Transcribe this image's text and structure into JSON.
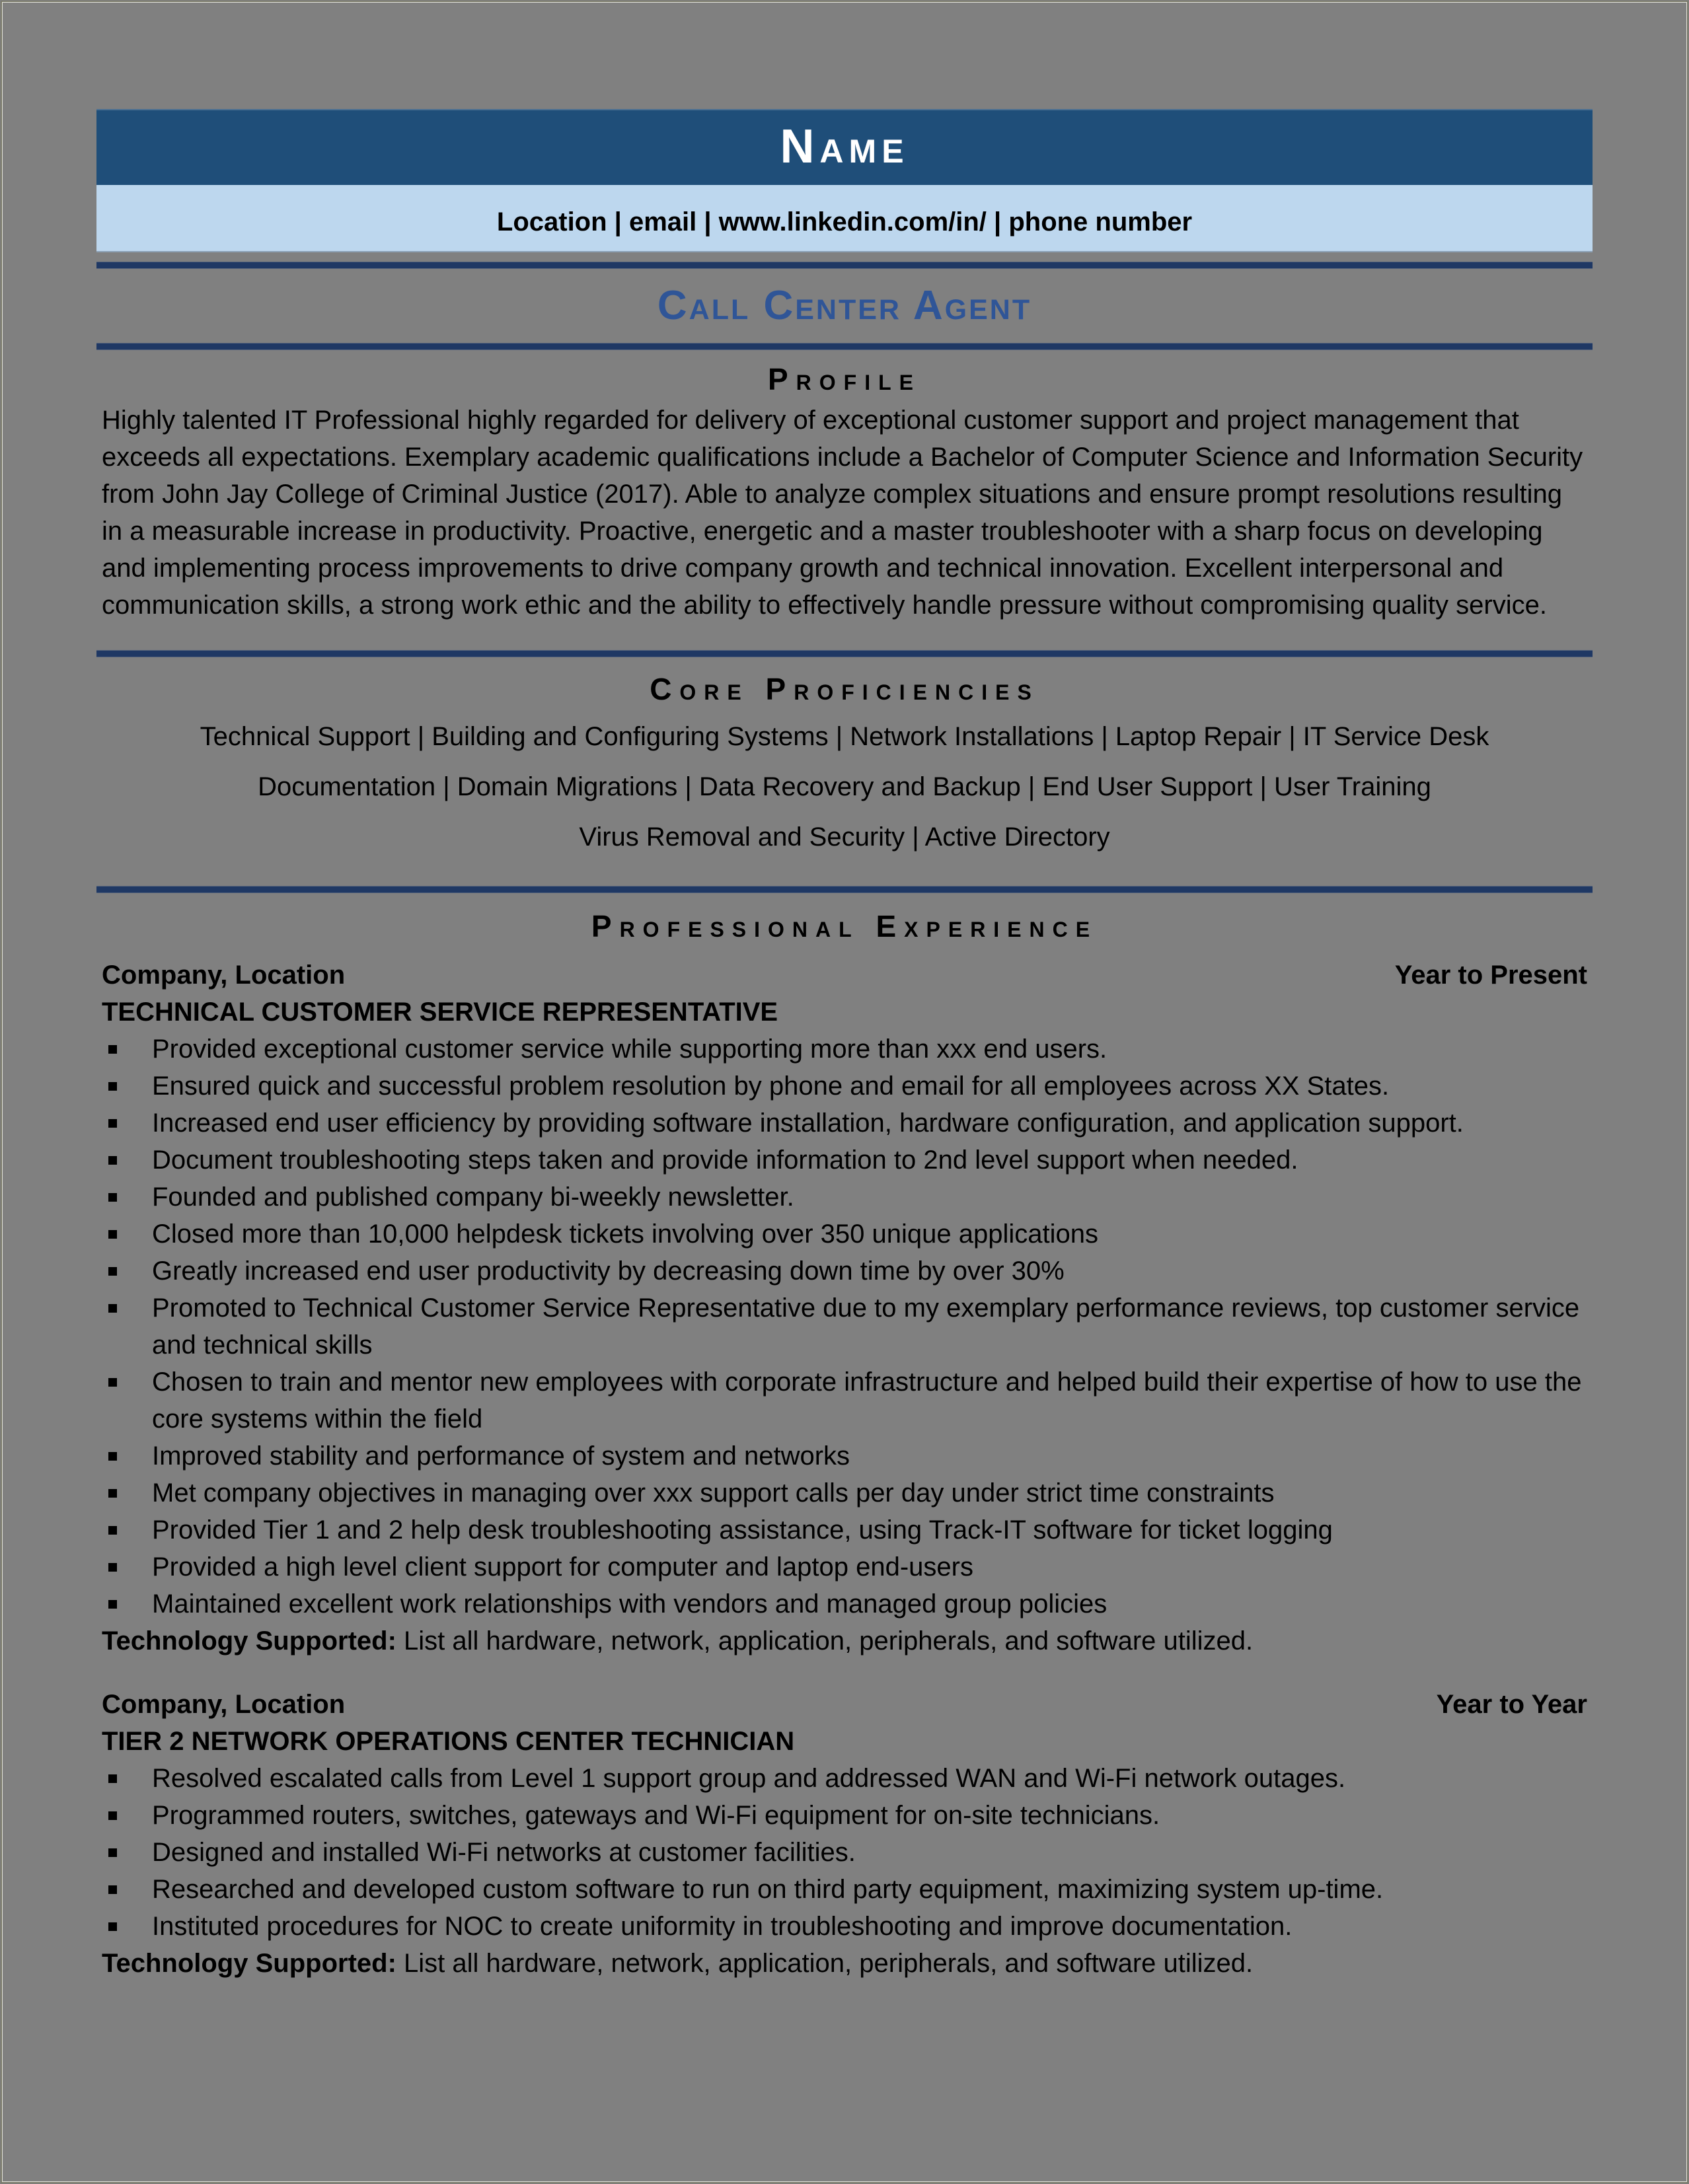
{
  "header": {
    "name": "Name",
    "contact": "Location | email | www.linkedin.com/in/ | phone number",
    "job_title": "Call Center Agent"
  },
  "colors": {
    "page_background": "#808080",
    "name_band": "#1f4e79",
    "contact_band": "#bdd7ee",
    "rule": "#1f3864",
    "job_title": "#2f5597"
  },
  "profile": {
    "heading": "Profile",
    "text": "Highly talented IT Professional highly regarded for delivery of exceptional customer support and project management that exceeds all expectations. Exemplary academic qualifications include a Bachelor of Computer Science and Information Security from John Jay College of Criminal Justice (2017). Able to analyze complex situations and ensure prompt resolutions resulting in a measurable increase in productivity. Proactive, energetic and a master troubleshooter with a sharp focus on developing and implementing process improvements to drive company growth and technical innovation. Excellent interpersonal and communication skills, a strong work ethic and the ability to effectively handle pressure without compromising quality service."
  },
  "core_proficiencies": {
    "heading": "Core Proficiencies",
    "lines": [
      "Technical Support | Building and Configuring Systems | Network Installations | Laptop Repair | IT Service Desk",
      "Documentation | Domain Migrations | Data Recovery and Backup | End User Support | User Training",
      "Virus Removal and Security | Active Directory"
    ]
  },
  "experience": {
    "heading": "Professional Experience",
    "jobs": [
      {
        "company": "Company, Location",
        "dates": "Year to Present",
        "role": "TECHNICAL CUSTOMER SERVICE REPRESENTATIVE",
        "bullets": [
          "Provided exceptional customer service while supporting more than xxx end users.",
          "Ensured quick and successful problem resolution by phone and email for all employees across XX States.",
          "Increased end user efficiency by providing software installation, hardware configuration, and application support.",
          "Document troubleshooting steps taken and provide information to 2nd level support when needed.",
          "Founded and published company bi-weekly newsletter.",
          "Closed more than 10,000 helpdesk tickets involving over 350 unique applications",
          "Greatly increased end user productivity by decreasing down time by over 30%",
          "Promoted to Technical Customer Service Representative due to my exemplary performance reviews, top customer service and technical skills",
          "Chosen to train and mentor new employees with corporate infrastructure and helped build their expertise of how to use the core systems within the field",
          "Improved stability and performance of system and networks",
          "Met company objectives in managing over xxx support calls per day under strict time constraints",
          "Provided Tier 1 and 2 help desk troubleshooting assistance, using Track-IT software for ticket logging",
          "Provided a high level client support for computer and laptop end-users",
          "Maintained excellent work relationships with vendors and managed group policies"
        ],
        "tech_label": "Technology Supported:",
        "tech_text": " List all hardware, network, application, peripherals, and software utilized."
      },
      {
        "company": "Company, Location",
        "dates": "Year to Year",
        "role": "TIER 2 NETWORK OPERATIONS CENTER TECHNICIAN",
        "bullets": [
          "Resolved escalated calls from Level 1 support group and addressed WAN and Wi-Fi network outages.",
          "Programmed routers, switches, gateways and Wi-Fi equipment for on-site technicians.",
          "Designed and installed Wi-Fi networks at customer facilities.",
          "Researched and developed custom software to run on third party equipment, maximizing system up-time.",
          "Instituted procedures for NOC to create uniformity in troubleshooting and improve documentation."
        ],
        "tech_label": "Technology Supported:",
        "tech_text": " List all hardware, network, application, peripherals, and software utilized."
      }
    ]
  }
}
